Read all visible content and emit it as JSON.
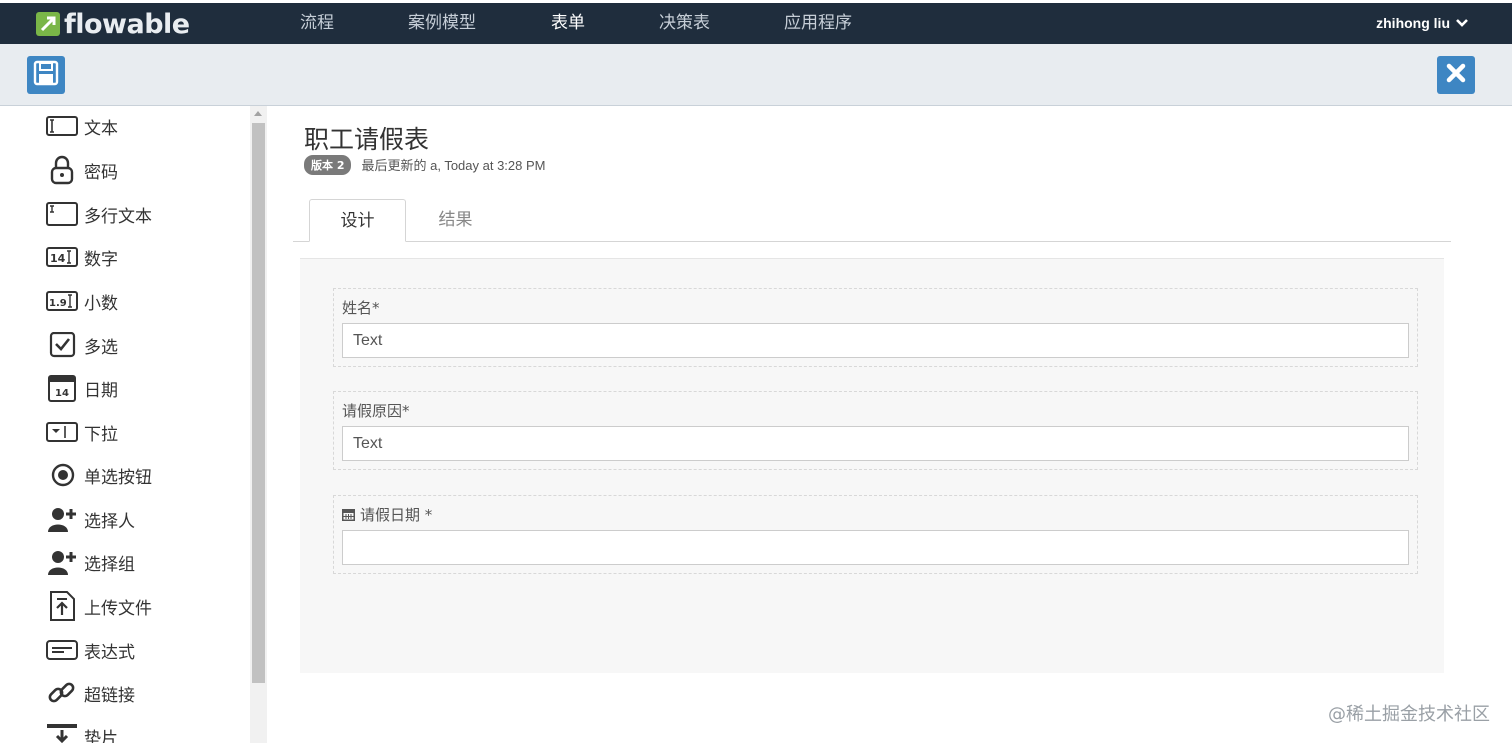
{
  "app": {
    "logo_text": "flowable",
    "brand_color": "#7ab648",
    "nav_bg": "#1f2d3d",
    "accent": "#3e86c3"
  },
  "nav": {
    "items": [
      {
        "label": "流程"
      },
      {
        "label": "案例模型"
      },
      {
        "label": "表单",
        "active": true
      },
      {
        "label": "决策表"
      },
      {
        "label": "应用程序"
      }
    ],
    "user": "zhihong liu"
  },
  "toolbar": {
    "save_icon": "save-icon",
    "close_icon": "close-icon"
  },
  "palette": {
    "items": [
      {
        "label": "文本",
        "icon": "text-field-icon"
      },
      {
        "label": "密码",
        "icon": "lock-icon"
      },
      {
        "label": "多行文本",
        "icon": "multiline-text-icon"
      },
      {
        "label": "数字",
        "icon": "number-icon"
      },
      {
        "label": "小数",
        "icon": "decimal-icon"
      },
      {
        "label": "多选",
        "icon": "checkbox-icon"
      },
      {
        "label": "日期",
        "icon": "calendar-icon"
      },
      {
        "label": "下拉",
        "icon": "dropdown-icon"
      },
      {
        "label": "单选按钮",
        "icon": "radio-icon"
      },
      {
        "label": "选择人",
        "icon": "add-user-icon"
      },
      {
        "label": "选择组",
        "icon": "add-group-icon"
      },
      {
        "label": "上传文件",
        "icon": "upload-file-icon"
      },
      {
        "label": "表达式",
        "icon": "expression-icon"
      },
      {
        "label": "超链接",
        "icon": "link-icon"
      },
      {
        "label": "垫片",
        "icon": "spacer-icon"
      }
    ]
  },
  "form": {
    "title": "职工请假表",
    "version_badge": "版本 2",
    "last_updated": "最后更新的 a, Today at 3:28 PM",
    "tabs": [
      {
        "label": "设计",
        "active": true
      },
      {
        "label": "结果"
      }
    ],
    "fields": [
      {
        "label": "姓名*",
        "value": "Text"
      },
      {
        "label": "请假原因*",
        "value": "Text"
      },
      {
        "label": "请假日期 *",
        "value": "",
        "icon": "calendar-icon"
      }
    ]
  },
  "watermark": "@稀土掘金技术社区"
}
